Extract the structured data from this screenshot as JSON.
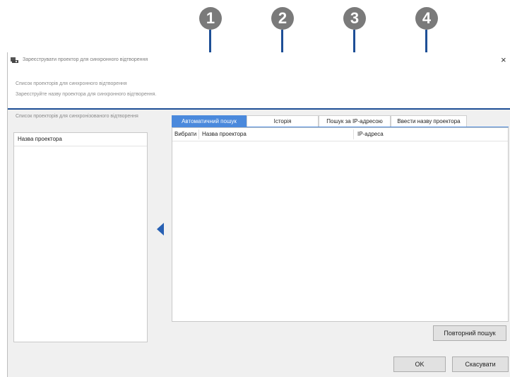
{
  "markers": [
    {
      "number": "1"
    },
    {
      "number": "2"
    },
    {
      "number": "3"
    },
    {
      "number": "4"
    }
  ],
  "dialog": {
    "title": "Зареєструвати проектор для синхронного відтворення",
    "close_label": "×",
    "info_heading": "Список проекторів для синхронного відтворення",
    "info_text": "Зареєструйте назву проектора для синхронного відтворення."
  },
  "left_panel": {
    "title": "Список проекторів для синхронізованого відтворення",
    "column_header": "Назва проектора"
  },
  "tabs": [
    {
      "label": "Автоматичний пошук",
      "active": true
    },
    {
      "label": "Історія",
      "active": false
    },
    {
      "label": "Пошук за IP-адресою",
      "active": false
    },
    {
      "label": "Ввести назву проектора",
      "active": false
    }
  ],
  "table": {
    "columns": [
      "Вибрати",
      "Назва проектора",
      "IP-адреса"
    ],
    "rows": []
  },
  "buttons": {
    "research": "Повторний пошук",
    "ok": "OK",
    "cancel": "Скасувати"
  },
  "colors": {
    "accent": "#4a89dc",
    "marker_line": "#1e4f96",
    "marker": "#7a7a7a",
    "arrow": "#2760b3"
  },
  "icons": {
    "title": "projector-icon",
    "move": "arrow-left-icon"
  }
}
